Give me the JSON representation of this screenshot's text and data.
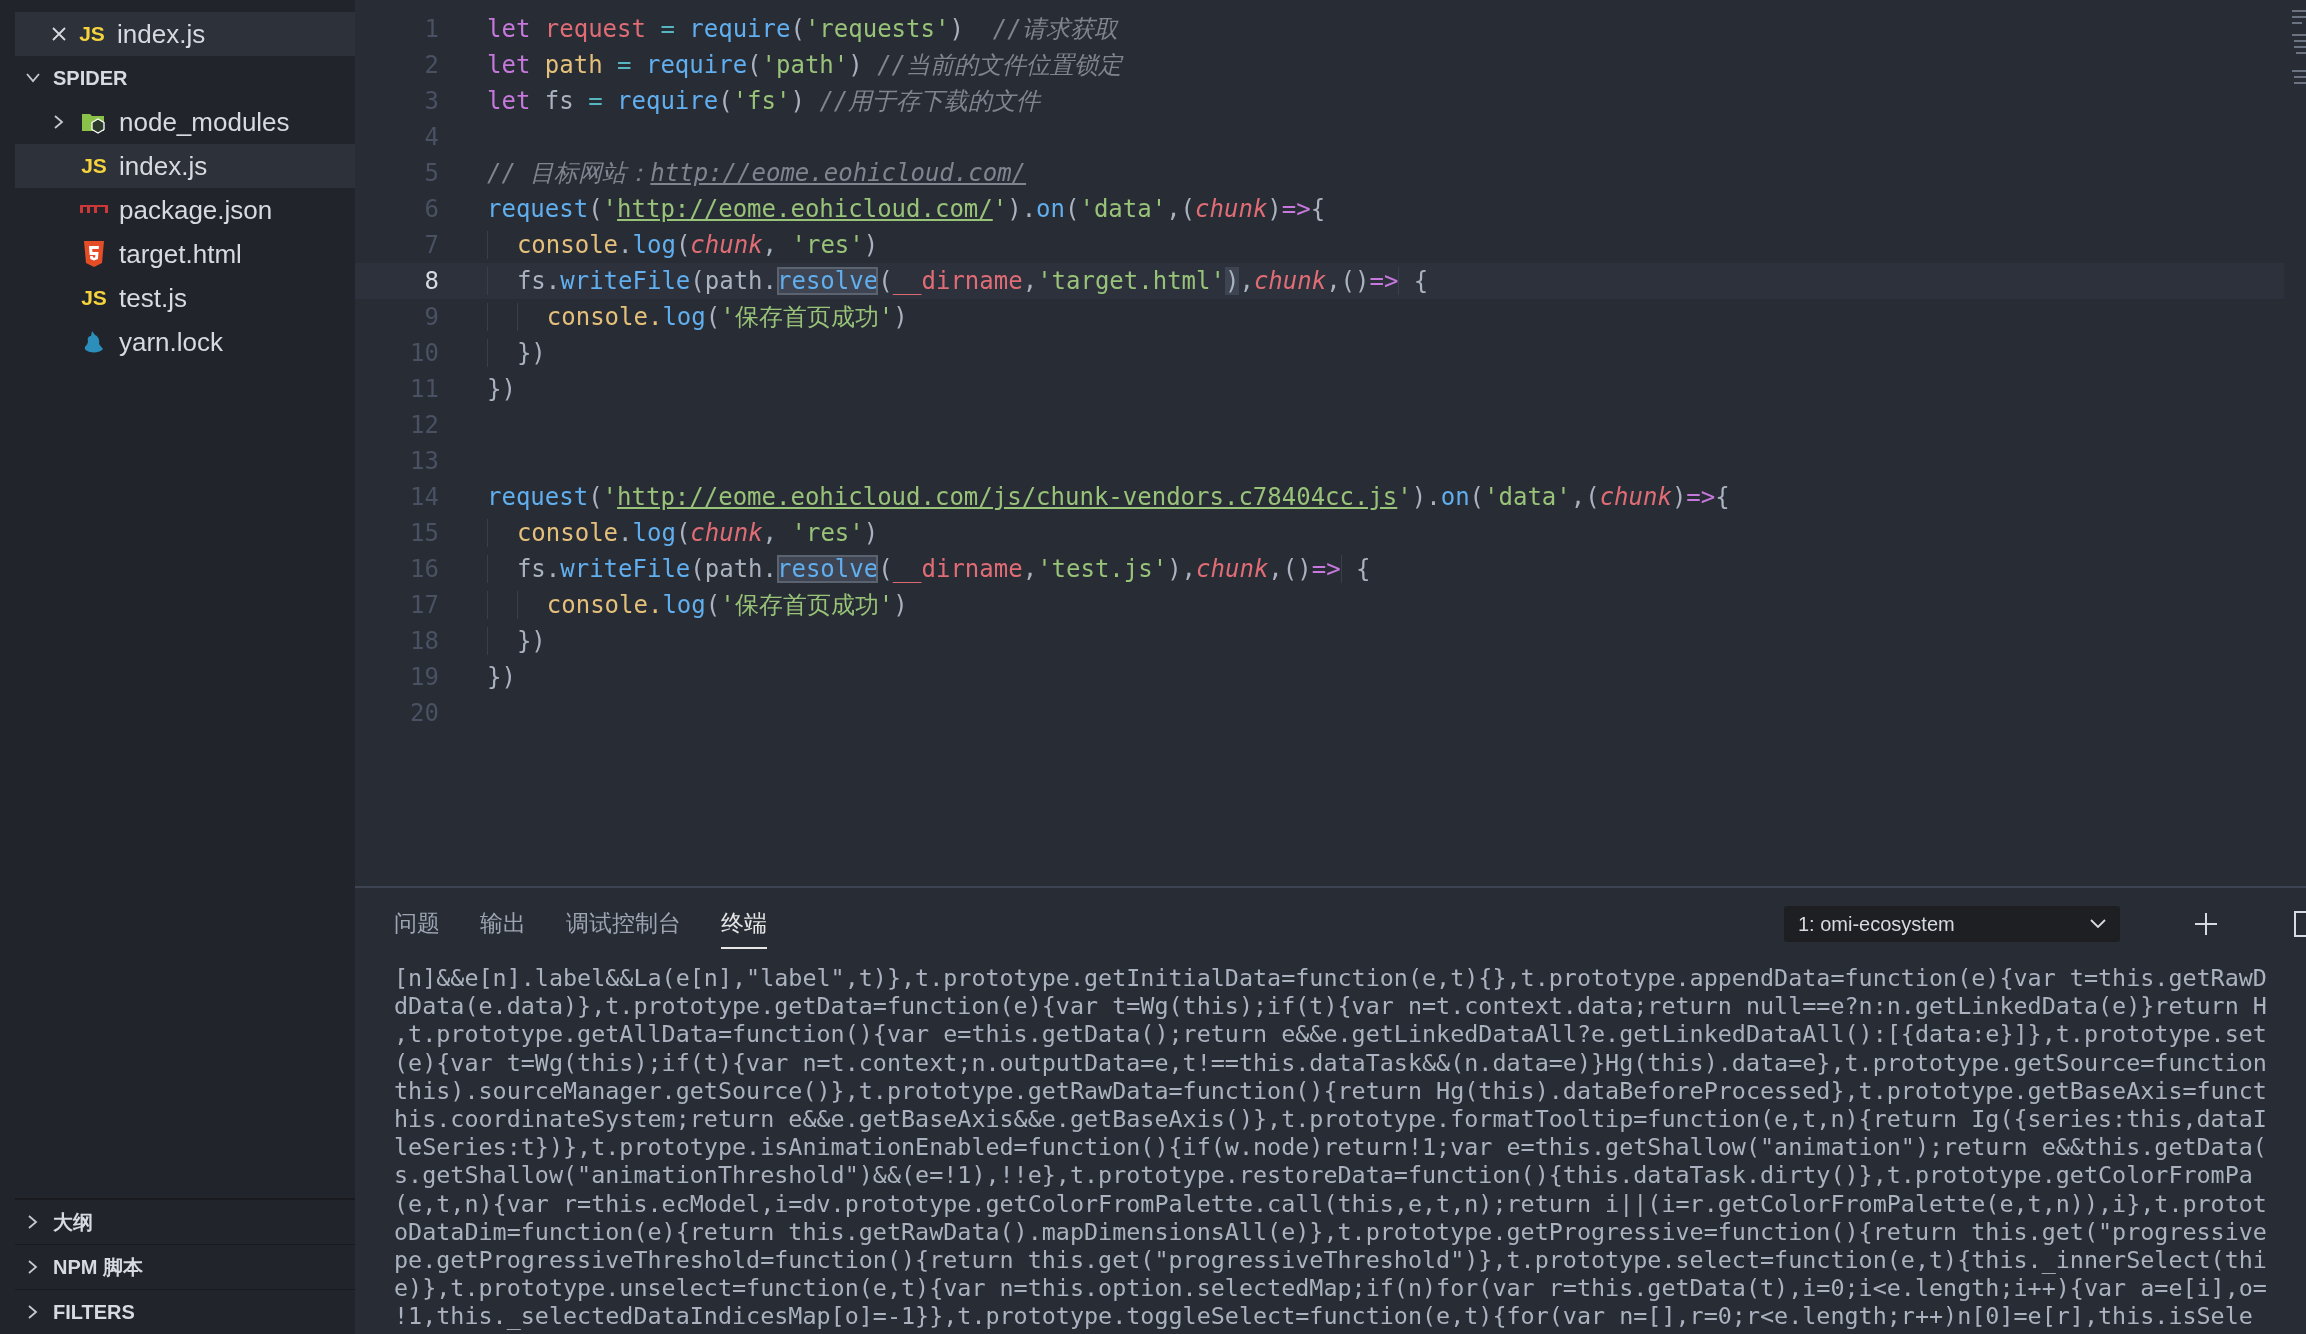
{
  "open_editors": [
    {
      "name": "index.js",
      "kind": "js",
      "icon_label": "JS"
    }
  ],
  "explorer": {
    "title": "SPIDER",
    "expanded": true,
    "items": [
      {
        "name": "node_modules",
        "kind": "folder",
        "expanded": false,
        "selected": false
      },
      {
        "name": "index.js",
        "kind": "js",
        "icon_label": "JS",
        "selected": true
      },
      {
        "name": "package.json",
        "kind": "npm",
        "selected": false
      },
      {
        "name": "target.html",
        "kind": "html",
        "selected": false
      },
      {
        "name": "test.js",
        "kind": "js",
        "icon_label": "JS",
        "selected": false
      },
      {
        "name": "yarn.lock",
        "kind": "yarn",
        "selected": false
      }
    ]
  },
  "sections": [
    {
      "title": "大纲",
      "expanded": false
    },
    {
      "title": "NPM 脚本",
      "expanded": false
    },
    {
      "title": "FILTERS",
      "expanded": false
    }
  ],
  "editor": {
    "lines": [
      {
        "number": "1",
        "current": false,
        "tokens": [
          {
            "text": "let ",
            "kind": "kw"
          },
          {
            "text": "request ",
            "kind": "var"
          },
          {
            "text": "= ",
            "kind": "op"
          },
          {
            "text": "require",
            "kind": "fn"
          },
          {
            "text": "(",
            "kind": "pn"
          },
          {
            "text": "'requests'",
            "kind": "str"
          },
          {
            "text": ")  ",
            "kind": "pn"
          },
          {
            "text": "//请求获取",
            "kind": "cm"
          }
        ]
      },
      {
        "number": "2",
        "current": false,
        "tokens": [
          {
            "text": "let ",
            "kind": "kw"
          },
          {
            "text": "path ",
            "kind": "obj"
          },
          {
            "text": "= ",
            "kind": "op"
          },
          {
            "text": "require",
            "kind": "fn"
          },
          {
            "text": "(",
            "kind": "pn"
          },
          {
            "text": "'path'",
            "kind": "str"
          },
          {
            "text": ") ",
            "kind": "pn"
          },
          {
            "text": "//当前的文件位置锁定",
            "kind": "cm"
          }
        ]
      },
      {
        "number": "3",
        "current": false,
        "tokens": [
          {
            "text": "let ",
            "kind": "kw"
          },
          {
            "text": "fs ",
            "kind": "pn"
          },
          {
            "text": "= ",
            "kind": "op"
          },
          {
            "text": "require",
            "kind": "fn"
          },
          {
            "text": "(",
            "kind": "pn"
          },
          {
            "text": "'fs'",
            "kind": "str"
          },
          {
            "text": ") ",
            "kind": "pn"
          },
          {
            "text": "//用于存下载的文件",
            "kind": "cm"
          }
        ]
      },
      {
        "number": "4",
        "current": false
      },
      {
        "number": "5",
        "current": false,
        "tokens": [
          {
            "text": "// 目标网站：",
            "kind": "cm"
          },
          {
            "text": "http://eome.eohicloud.com/",
            "kind": "cmlink"
          }
        ]
      },
      {
        "number": "6",
        "current": false,
        "tokens": [
          {
            "text": "request",
            "kind": "fn"
          },
          {
            "text": "(",
            "kind": "pn"
          },
          {
            "text": "'",
            "kind": "str"
          },
          {
            "text": "http://eome.eohicloud.com/",
            "kind": "link"
          },
          {
            "text": "'",
            "kind": "str"
          },
          {
            "text": ").",
            "kind": "pn"
          },
          {
            "text": "on",
            "kind": "fn"
          },
          {
            "text": "(",
            "kind": "pn"
          },
          {
            "text": "'data'",
            "kind": "str"
          },
          {
            "text": ",(",
            "kind": "pn"
          },
          {
            "text": "chunk",
            "kind": "param"
          },
          {
            "text": ")",
            "kind": "pn"
          },
          {
            "text": "=>",
            "kind": "kw"
          },
          {
            "text": "{",
            "kind": "pn"
          }
        ]
      },
      {
        "number": "7",
        "current": false,
        "tokens": [
          {
            "text": "  console",
            "kind": "obj"
          },
          {
            "text": ".",
            "kind": "pn"
          },
          {
            "text": "log",
            "kind": "fn"
          },
          {
            "text": "(",
            "kind": "pn"
          },
          {
            "text": "chunk",
            "kind": "param"
          },
          {
            "text": ", ",
            "kind": "pn"
          },
          {
            "text": "'res'",
            "kind": "str"
          },
          {
            "text": ")",
            "kind": "pn"
          }
        ]
      },
      {
        "number": "8",
        "current": true,
        "tokens": [
          {
            "text": "  fs.",
            "kind": "pn"
          },
          {
            "text": "writeFile",
            "kind": "fn"
          },
          {
            "text": "(path.",
            "kind": "pn"
          },
          {
            "text": "resolve",
            "kind": "match"
          },
          {
            "text": "(",
            "kind": "pn"
          },
          {
            "text": "__dirname",
            "kind": "var"
          },
          {
            "text": ",",
            "kind": "pn"
          },
          {
            "text": "'target.html'",
            "kind": "str"
          },
          {
            "text": ")",
            "kind": "bracket"
          },
          {
            "text": ",",
            "kind": "pn"
          },
          {
            "text": "chunk",
            "kind": "param"
          },
          {
            "text": ",()",
            "kind": "pn"
          },
          {
            "text": "=>",
            "kind": "kw"
          },
          {
            "text": " {",
            "kind": "pn"
          }
        ]
      },
      {
        "number": "9",
        "current": false,
        "tokens": [
          {
            "text": "    console.",
            "kind": "obj"
          },
          {
            "text": "log",
            "kind": "fn"
          },
          {
            "text": "(",
            "kind": "pn"
          },
          {
            "text": "'保存首页成功'",
            "kind": "str"
          },
          {
            "text": ")",
            "kind": "pn"
          }
        ]
      },
      {
        "number": "10",
        "current": false,
        "tokens": [
          {
            "text": "  })",
            "kind": "pn"
          }
        ]
      },
      {
        "number": "11",
        "current": false,
        "tokens": [
          {
            "text": "})",
            "kind": "pn"
          }
        ]
      },
      {
        "number": "12",
        "current": false
      },
      {
        "number": "13",
        "current": false
      },
      {
        "number": "14",
        "current": false,
        "tokens": [
          {
            "text": "request",
            "kind": "fn"
          },
          {
            "text": "(",
            "kind": "pn"
          },
          {
            "text": "'",
            "kind": "str"
          },
          {
            "text": "http://eome.eohicloud.com/js/chunk-vendors.c78404cc.js",
            "kind": "link"
          },
          {
            "text": "'",
            "kind": "str"
          },
          {
            "text": ").",
            "kind": "pn"
          },
          {
            "text": "on",
            "kind": "fn"
          },
          {
            "text": "(",
            "kind": "pn"
          },
          {
            "text": "'data'",
            "kind": "str"
          },
          {
            "text": ",(",
            "kind": "pn"
          },
          {
            "text": "chunk",
            "kind": "param"
          },
          {
            "text": ")",
            "kind": "pn"
          },
          {
            "text": "=>",
            "kind": "kw"
          },
          {
            "text": "{",
            "kind": "pn"
          }
        ]
      },
      {
        "number": "15",
        "current": false,
        "tokens": [
          {
            "text": "  console",
            "kind": "obj"
          },
          {
            "text": ".",
            "kind": "pn"
          },
          {
            "text": "log",
            "kind": "fn"
          },
          {
            "text": "(",
            "kind": "pn"
          },
          {
            "text": "chunk",
            "kind": "param"
          },
          {
            "text": ", ",
            "kind": "pn"
          },
          {
            "text": "'res'",
            "kind": "str"
          },
          {
            "text": ")",
            "kind": "pn"
          }
        ]
      },
      {
        "number": "16",
        "current": false,
        "tokens": [
          {
            "text": "  fs.",
            "kind": "pn"
          },
          {
            "text": "writeFile",
            "kind": "fn"
          },
          {
            "text": "(path.",
            "kind": "pn"
          },
          {
            "text": "resolve",
            "kind": "match"
          },
          {
            "text": "(",
            "kind": "pn"
          },
          {
            "text": "__dirname",
            "kind": "var"
          },
          {
            "text": ",",
            "kind": "pn"
          },
          {
            "text": "'test.js'",
            "kind": "str"
          },
          {
            "text": "),",
            "kind": "pn"
          },
          {
            "text": "chunk",
            "kind": "param"
          },
          {
            "text": ",()",
            "kind": "pn"
          },
          {
            "text": "=>",
            "kind": "kw"
          },
          {
            "text": " {",
            "kind": "pn"
          }
        ]
      },
      {
        "number": "17",
        "current": false,
        "tokens": [
          {
            "text": "    console.",
            "kind": "obj"
          },
          {
            "text": "log",
            "kind": "fn"
          },
          {
            "text": "(",
            "kind": "pn"
          },
          {
            "text": "'保存首页成功'",
            "kind": "str"
          },
          {
            "text": ")",
            "kind": "pn"
          }
        ]
      },
      {
        "number": "18",
        "current": false,
        "tokens": [
          {
            "text": "  })",
            "kind": "pn"
          }
        ]
      },
      {
        "number": "19",
        "current": false,
        "tokens": [
          {
            "text": "})",
            "kind": "pn"
          }
        ]
      },
      {
        "number": "20",
        "current": false
      }
    ]
  },
  "panel": {
    "tabs": [
      {
        "label": "问题",
        "selected": false
      },
      {
        "label": "输出",
        "selected": false
      },
      {
        "label": "调试控制台",
        "selected": false
      },
      {
        "label": "终端",
        "selected": true
      }
    ],
    "terminal_select": "1: omi-ecosystem",
    "terminal_lines": [
      "[n]&&e[n].label&&La(e[n],\"label\",t)},t.prototype.getInitialData=function(e,t){},t.prototype.appendData=function(e){var t=this.getRawD",
      "dData(e.data)},t.prototype.getData=function(e){var t=Wg(this);if(t){var n=t.context.data;return null==e?n:n.getLinkedData(e)}return H",
      ",t.prototype.getAllData=function(){var e=this.getData();return e&&e.getLinkedDataAll?e.getLinkedDataAll():[{data:e}]},t.prototype.set",
      "(e){var t=Wg(this);if(t){var n=t.context;n.outputData=e,t!==this.dataTask&&(n.data=e)}Hg(this).data=e},t.prototype.getSource=function",
      "this).sourceManager.getSource()},t.prototype.getRawData=function(){return Hg(this).dataBeforeProcessed},t.prototype.getBaseAxis=funct",
      "his.coordinateSystem;return e&&e.getBaseAxis&&e.getBaseAxis()},t.prototype.formatTooltip=function(e,t,n){return Ig({series:this,dataI",
      "leSeries:t})},t.prototype.isAnimationEnabled=function(){if(w.node)return!1;var e=this.getShallow(\"animation\");return e&&this.getData(",
      "s.getShallow(\"animationThreshold\")&&(e=!1),!!e},t.prototype.restoreData=function(){this.dataTask.dirty()},t.prototype.getColorFromPa",
      "(e,t,n){var r=this.ecModel,i=dv.prototype.getColorFromPalette.call(this,e,t,n);return i||(i=r.getColorFromPalette(e,t,n)),i},t.protot",
      "oDataDim=function(e){return this.getRawData().mapDimensionsAll(e)},t.prototype.getProgressive=function(){return this.get(\"progressive",
      "pe.getProgressiveThreshold=function(){return this.get(\"progressiveThreshold\")},t.prototype.select=function(e,t){this._innerSelect(thi",
      "e)},t.prototype.unselect=function(e,t){var n=this.option.selectedMap;if(n)for(var r=this.getData(t),i=0;i<e.length;i++){var a=e[i],o=",
      "!1,this._selectedDataIndicesMap[o]=-1}},t.prototype.toggleSelect=function(e,t){for(var n=[],r=0;r<e.length;r++)n[0]=e[r],this.isSele"
    ]
  }
}
